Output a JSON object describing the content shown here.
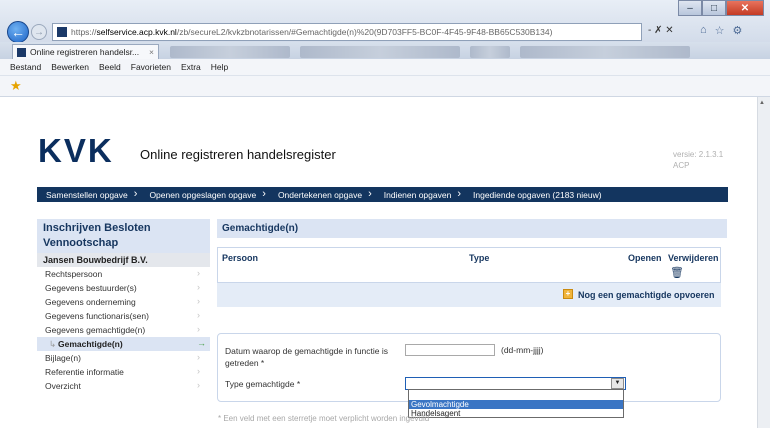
{
  "browser": {
    "url_prefix": "https://",
    "url_host": "selfservice.acp.kvk.nl",
    "url_path": "/zb/secureL2/kvkzbnotarissen/#Gemachtigde(n)%20(9D703FF5-BC0F-4F45-9F48-BB65C530B134)",
    "tab_title": "Online registreren handelsr...",
    "tab_close": "×",
    "menu": [
      "Bestand",
      "Bewerken",
      "Beeld",
      "Favorieten",
      "Extra",
      "Help"
    ],
    "controls": "- ✗ ✕",
    "colors": {
      "back_button": "#1d63c6",
      "chrome": "#d3dcea"
    }
  },
  "header": {
    "logo": "KVK",
    "app_title": "Online registreren handelsregister",
    "version": "versie: 2.1.3.1",
    "env": "ACP"
  },
  "steps": [
    "Samenstellen opgave",
    "Openen opgeslagen opgave",
    "Ondertekenen opgave",
    "Indienen opgaven",
    "Ingediende opgaven (2183 nieuw)"
  ],
  "sidebar": {
    "title": "Inschrijven Besloten Vennootschap",
    "company": "Jansen Bouwbedrijf B.V.",
    "items": [
      {
        "label": "Rechtspersoon"
      },
      {
        "label": "Gegevens bestuurder(s)"
      },
      {
        "label": "Gegevens onderneming"
      },
      {
        "label": "Gegevens functionaris(sen)"
      },
      {
        "label": "Gegevens gemachtigde(n)"
      },
      {
        "label": "Gemachtigde(n)",
        "active": true
      },
      {
        "label": "Bijlage(n)"
      },
      {
        "label": "Referentie informatie"
      },
      {
        "label": "Overzicht"
      }
    ],
    "chevron": "›"
  },
  "main": {
    "title": "Gemachtigde(n)",
    "columns": [
      "Persoon",
      "Type",
      "Openen",
      "Verwijderen"
    ],
    "add_link": "Nog een gemachtigde opvoeren",
    "form": {
      "date_label": "Datum waarop de gemachtigde in functie is getreden *",
      "date_value": "",
      "date_hint": "(dd-mm-jjjj)",
      "type_label": "Type gemachtigde *",
      "type_value": "",
      "type_options": [
        "Gevolmachtigde",
        "Handelsagent"
      ]
    },
    "footnote": "* Een veld met een sterretje moet verplicht worden ingevuld"
  }
}
